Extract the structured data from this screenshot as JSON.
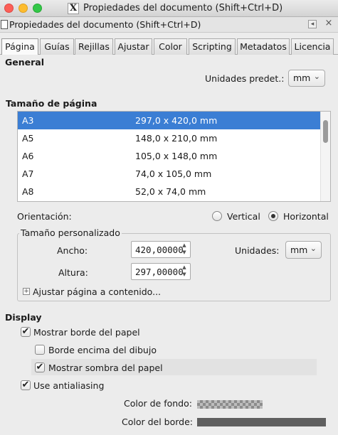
{
  "window": {
    "title": "Propiedades del documento (Shift+Ctrl+D)"
  },
  "panel": {
    "title": "Propiedades del documento (Shift+Ctrl+D)"
  },
  "tabs": [
    {
      "label": "Página",
      "active": true
    },
    {
      "label": "Guías"
    },
    {
      "label": "Rejillas"
    },
    {
      "label": "Ajustar"
    },
    {
      "label": "Color"
    },
    {
      "label": "Scripting"
    },
    {
      "label": "Metadatos"
    },
    {
      "label": "Licencia"
    }
  ],
  "general": {
    "header": "General",
    "default_units_label": "Unidades predet.:",
    "default_units_value": "mm"
  },
  "page_size": {
    "header": "Tamaño de página",
    "rows": [
      {
        "name": "A3",
        "size": "297,0 x 420,0 mm",
        "selected": true
      },
      {
        "name": "A5",
        "size": "148,0 x 210,0 mm"
      },
      {
        "name": "A6",
        "size": "105,0 x 148,0 mm"
      },
      {
        "name": "A7",
        "size": "74,0 x 105,0 mm"
      },
      {
        "name": "A8",
        "size": "52,0 x 74,0 mm"
      }
    ]
  },
  "orientation": {
    "label": "Orientación:",
    "vertical": "Vertical",
    "horizontal": "Horizontal",
    "selected": "Horizontal"
  },
  "custom_size": {
    "title": "Tamaño personalizado",
    "width_label": "Ancho:",
    "width_value": "420,00000",
    "height_label": "Altura:",
    "height_value": "297,00000",
    "units_label": "Unidades:",
    "units_value": "mm",
    "fit_label": "Ajustar página a contenido..."
  },
  "display": {
    "header": "Display",
    "show_border": {
      "label": "Mostrar borde del papel",
      "checked": true
    },
    "border_on_top": {
      "label": "Borde encima del dibujo",
      "checked": false
    },
    "show_shadow": {
      "label": "Mostrar sombra del papel",
      "checked": true
    },
    "antialiasing": {
      "label": "Use antialiasing",
      "checked": true
    },
    "background_color_label": "Color de fondo:",
    "border_color_label": "Color del borde:"
  },
  "icons": {
    "check": "✔",
    "chevron": "⌄",
    "spin_up": "▲",
    "spin_down": "▼",
    "expand": "+",
    "close": "×",
    "dock": "◂",
    "x11": "X"
  }
}
